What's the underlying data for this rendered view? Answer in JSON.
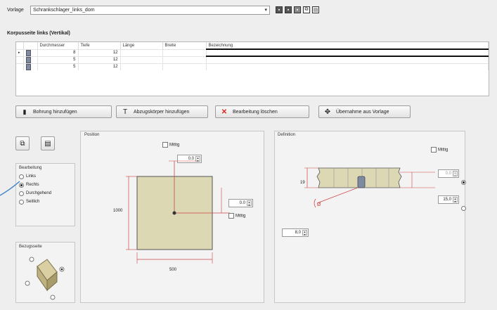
{
  "vorlage": {
    "label": "Vorlage",
    "value": "Schrankschlager_links_dom"
  },
  "toolbar": {
    "icons": [
      "save-icon",
      "save-as-icon",
      "save-copy-icon",
      "copy-icon",
      "paste-icon"
    ]
  },
  "section_title": "Korpusseite links (Vertikal)",
  "table": {
    "headers": [
      "Durchmesser",
      "Tiefe",
      "Länge",
      "Breite",
      "Bezeichnung"
    ],
    "rows": [
      {
        "durchmesser": "8",
        "tiefe": "12",
        "laenge": "",
        "breite": "",
        "bez": ""
      },
      {
        "durchmesser": "5",
        "tiefe": "12",
        "laenge": "",
        "breite": "",
        "bez": ""
      },
      {
        "durchmesser": "5",
        "tiefe": "12",
        "laenge": "",
        "breite": "",
        "bez": ""
      }
    ]
  },
  "actions": {
    "add_bore": "Bohrung hinzufügen",
    "add_cut": "Abzugskörper hinzufügen",
    "delete": "Bearbeitung löschen",
    "take_over": "Übernahme aus Vorlage"
  },
  "bearbeitung": {
    "title": "Bearbeitung",
    "options": [
      "Links",
      "Rechts",
      "Durchgehend",
      "Seitlich"
    ],
    "selected": "Rechts"
  },
  "bezugsseite": {
    "title": "Bezugsseite"
  },
  "position": {
    "title": "Position",
    "mittig_top": "Mittig",
    "value_top": "0.0",
    "value_right": "0.0",
    "mittig_right": "Mittig",
    "height_label": "1000",
    "width_label": "500"
  },
  "definition": {
    "title": "Definition",
    "mittig": "Mittig",
    "dim_left": "19",
    "value_a": "0,0",
    "value_b": "15,0",
    "value_c": "8,0",
    "angle_label": "Ø"
  }
}
